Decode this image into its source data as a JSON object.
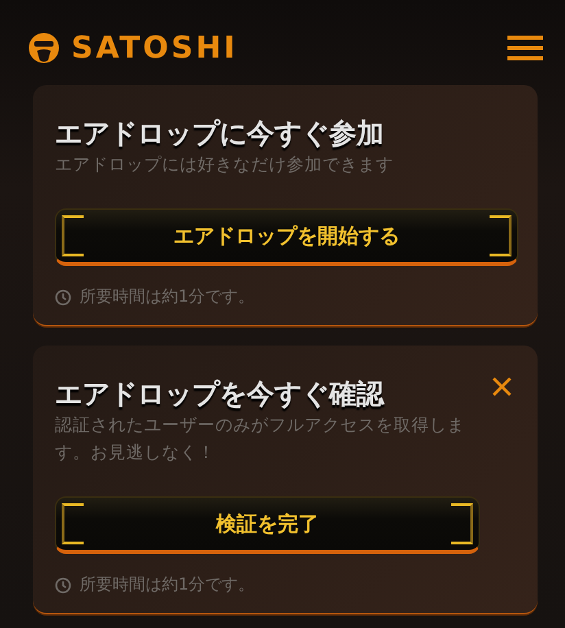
{
  "header": {
    "brand": "SATOSHI"
  },
  "cards": [
    {
      "title": "エアドロップに今すぐ参加",
      "subtitle": "エアドロップには好きなだけ参加できます",
      "button": "エアドロップを開始する",
      "note": "所要時間は約1分です。",
      "dismissible": false
    },
    {
      "title": "エアドロップを今すぐ確認",
      "subtitle": "認証されたユーザーのみがフルアクセスを取得します。お見逃しなく！",
      "button": "検証を完了",
      "note": "所要時間は約1分です。",
      "dismissible": true
    }
  ]
}
